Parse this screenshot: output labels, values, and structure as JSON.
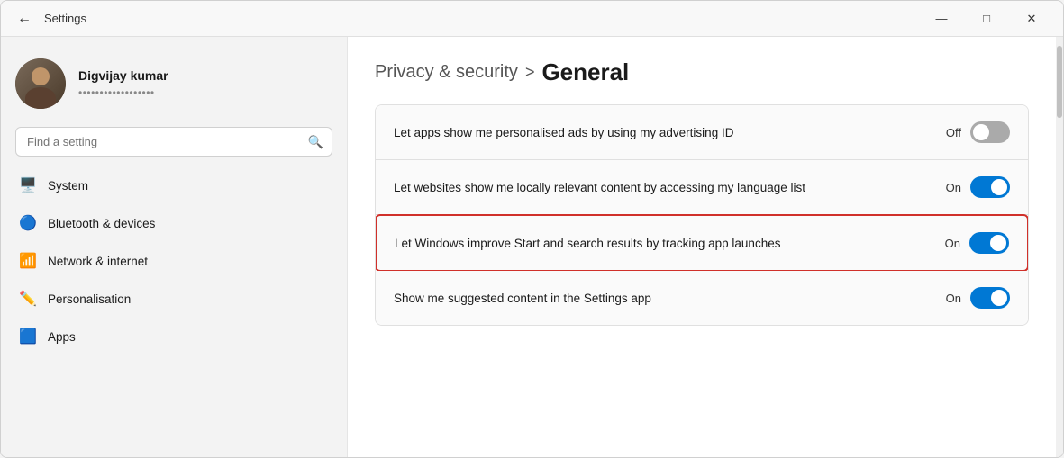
{
  "window": {
    "title": "Settings",
    "back_label": "←",
    "controls": {
      "minimize": "—",
      "maximize": "□",
      "close": "✕"
    }
  },
  "sidebar": {
    "user": {
      "name": "Digvijay kumar",
      "email": "••••••••••••••••••"
    },
    "search": {
      "placeholder": "Find a setting"
    },
    "nav_items": [
      {
        "id": "system",
        "label": "System",
        "icon": "🖥️"
      },
      {
        "id": "bluetooth",
        "label": "Bluetooth & devices",
        "icon": "🔵"
      },
      {
        "id": "network",
        "label": "Network & internet",
        "icon": "📶"
      },
      {
        "id": "personalisation",
        "label": "Personalisation",
        "icon": "✏️"
      },
      {
        "id": "apps",
        "label": "Apps",
        "icon": "🟦"
      }
    ]
  },
  "content": {
    "breadcrumb_parent": "Privacy & security",
    "breadcrumb_sep": ">",
    "breadcrumb_current": "General",
    "settings": [
      {
        "id": "ads",
        "label": "Let apps show me personalised ads by using my advertising ID",
        "status": "Off",
        "toggle_on": false,
        "highlighted": false
      },
      {
        "id": "language",
        "label": "Let websites show me locally relevant content by accessing my language list",
        "status": "On",
        "toggle_on": true,
        "highlighted": false
      },
      {
        "id": "tracking",
        "label": "Let Windows improve Start and search results by tracking app launches",
        "status": "On",
        "toggle_on": true,
        "highlighted": true
      },
      {
        "id": "suggestions",
        "label": "Show me suggested content in the Settings app",
        "status": "On",
        "toggle_on": true,
        "highlighted": false
      }
    ]
  }
}
